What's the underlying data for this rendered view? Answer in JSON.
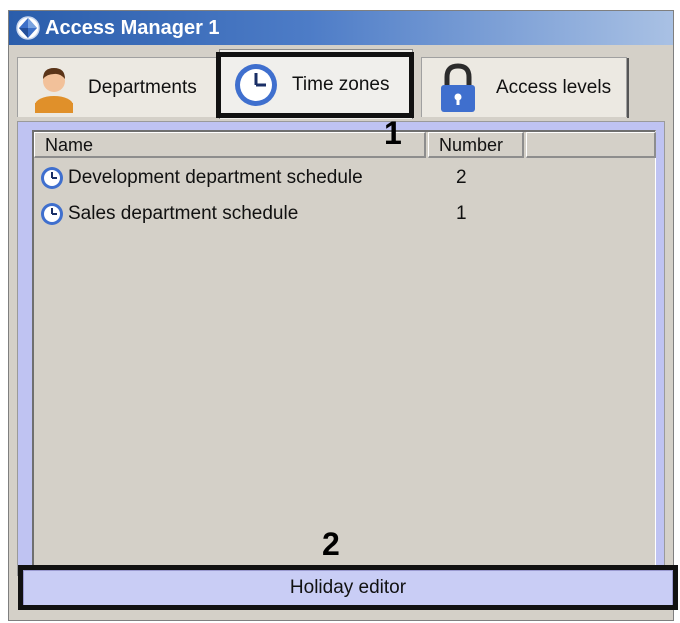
{
  "window": {
    "title": "Access Manager 1",
    "title_bar_color": "#2a5dab"
  },
  "tabs": [
    {
      "label": "Departments",
      "icon": "person-icon",
      "active": false
    },
    {
      "label": "Time zones",
      "icon": "clock-icon",
      "active": true
    },
    {
      "label": "Access levels",
      "icon": "padlock-icon",
      "active": false
    }
  ],
  "list": {
    "columns": [
      "Name",
      "Number"
    ],
    "rows": [
      {
        "name": "Development department schedule",
        "number": "2",
        "icon": "clock-icon"
      },
      {
        "name": "Sales department schedule",
        "number": "1",
        "icon": "clock-icon"
      }
    ]
  },
  "button": {
    "label": "Holiday editor"
  },
  "annotations": {
    "marker_1": "1",
    "marker_2": "2"
  }
}
